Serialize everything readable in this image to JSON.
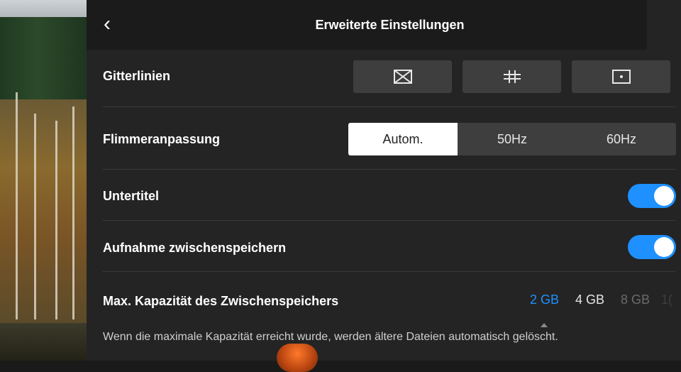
{
  "header": {
    "back_icon": "chevron-left-icon",
    "back_glyph": "‹",
    "title": "Erweiterte Einstellungen"
  },
  "gridlines": {
    "label": "Gitterlinien",
    "options": [
      {
        "icon": "diagonal-grid-icon"
      },
      {
        "icon": "grid-3x3-icon"
      },
      {
        "icon": "center-point-icon"
      }
    ]
  },
  "flicker": {
    "label": "Flimmeranpassung",
    "options": [
      "Autom.",
      "50Hz",
      "60Hz"
    ],
    "selected": "Autom."
  },
  "subtitles": {
    "label": "Untertitel",
    "enabled": true
  },
  "cache_recording": {
    "label": "Aufnahme zwischenspeichern",
    "enabled": true
  },
  "cache_capacity": {
    "label": "Max. Kapazität des Zwischenspeichers",
    "options": [
      "2 GB",
      "4 GB",
      "8 GB",
      "1("
    ],
    "selected": "2 GB",
    "note": "Wenn die maximale Kapazität erreicht wurde, werden ältere Dateien automatisch gelöscht."
  },
  "colors": {
    "accent": "#1e90ff",
    "selected_text": "#1e90ff"
  }
}
